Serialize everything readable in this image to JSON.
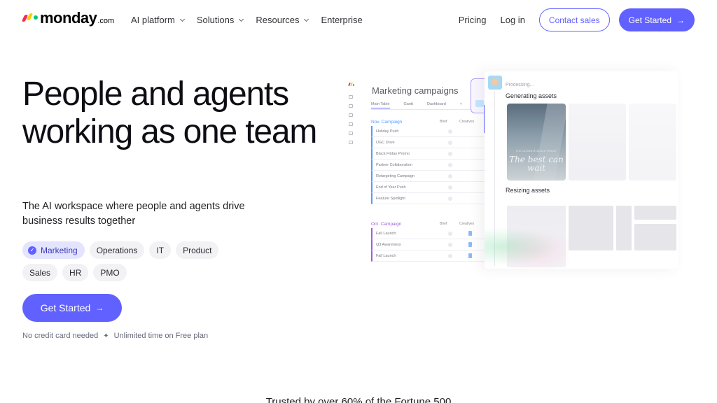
{
  "nav": {
    "logo_word": "monday",
    "logo_suffix": ".com",
    "links": [
      {
        "label": "AI platform",
        "has_menu": true
      },
      {
        "label": "Solutions",
        "has_menu": true
      },
      {
        "label": "Resources",
        "has_menu": true
      },
      {
        "label": "Enterprise",
        "has_menu": false
      }
    ],
    "pricing": "Pricing",
    "login": "Log in",
    "contact_sales": "Contact sales",
    "get_started": "Get Started"
  },
  "hero": {
    "title": "People and agents working as one team",
    "subtitle": "The AI workspace where people and agents drive business results together",
    "chips": [
      {
        "label": "Marketing",
        "selected": true
      },
      {
        "label": "Operations",
        "selected": false
      },
      {
        "label": "IT",
        "selected": false
      },
      {
        "label": "Product",
        "selected": false
      },
      {
        "label": "Sales",
        "selected": false
      },
      {
        "label": "HR",
        "selected": false
      },
      {
        "label": "PMO",
        "selected": false
      }
    ],
    "cta": "Get Started",
    "footnote_left": "No credit card needed",
    "footnote_right": "Unlimited time on Free plan"
  },
  "mockup": {
    "board_title": "Marketing campaigns",
    "tabs": [
      "Main Table",
      "Gantt",
      "Dashboard",
      "+"
    ],
    "group1": {
      "name": "Nov. Campaign",
      "columns": [
        "Brief",
        "Creatives"
      ],
      "rows": [
        "Holiday Push",
        "UGC Drive",
        "Black Friday Promo",
        "Partner Collaboration",
        "Retargeting Campaign",
        "End of Year Push",
        "Feature Spotlight"
      ]
    },
    "group2": {
      "name": "Oct. Campaign",
      "columns": [
        "Brief",
        "Creatives"
      ],
      "rows": [
        "Fall Launch",
        "Q3 Awareness",
        "Fall Launch"
      ]
    },
    "agent": {
      "processing": "Processing...",
      "step1": "Generating assets",
      "step2": "Resizing assets",
      "asset_text": "The best can wait",
      "asset_small": "THE ULTIMATE BLACK FRIDAY"
    }
  },
  "trusted": "Trusted by over 60% of the Fortune 500",
  "colors": {
    "accent": "#6161ff",
    "chip_active_bg": "#e4e4ff",
    "nov_group": "#579bfc",
    "oct_group": "#a25ddc"
  },
  "icons": {
    "arrow": "→",
    "check": "✓",
    "sparkle": "✦"
  }
}
